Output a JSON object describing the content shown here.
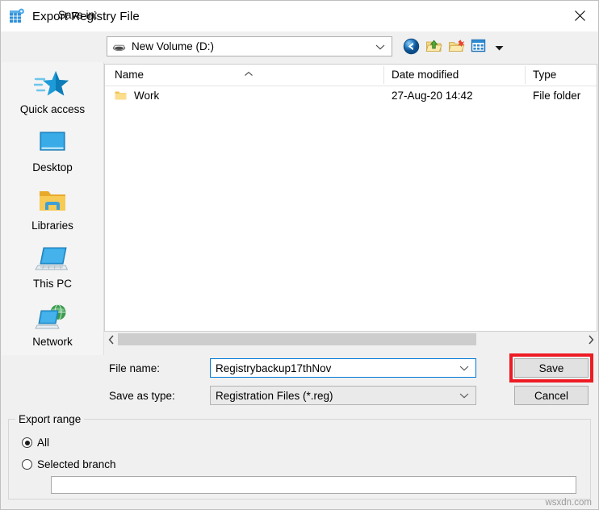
{
  "window": {
    "title": "Export Registry File",
    "icon": "registry-icon",
    "close_label": "×"
  },
  "savein": {
    "label": "Save in:",
    "value": "New Volume (D:)",
    "drive_icon": "hard-drive-icon"
  },
  "toolbar": {
    "buttons": [
      {
        "name": "back-button",
        "icon": "back-arrow-icon",
        "title": "Back"
      },
      {
        "name": "up-one-level-button",
        "icon": "folder-up-icon",
        "title": "Up One Level"
      },
      {
        "name": "create-new-folder-button",
        "icon": "new-folder-icon",
        "title": "Create New Folder"
      },
      {
        "name": "views-button",
        "icon": "views-icon",
        "title": "Views"
      }
    ]
  },
  "sidebar": {
    "items": [
      {
        "label": "Quick access",
        "icon": "star-icon"
      },
      {
        "label": "Desktop",
        "icon": "monitor-icon"
      },
      {
        "label": "Libraries",
        "icon": "libraries-folder-icon"
      },
      {
        "label": "This PC",
        "icon": "computer-icon"
      },
      {
        "label": "Network",
        "icon": "network-globe-icon"
      }
    ]
  },
  "filelist": {
    "columns": [
      "Name",
      "Date modified",
      "Type"
    ],
    "sort_indicator": "ascending",
    "rows": [
      {
        "name": "Work",
        "date_modified": "27-Aug-20 14:42",
        "type": "File folder",
        "icon": "folder-icon"
      }
    ]
  },
  "filename": {
    "label": "File name:",
    "value": "Registrybackup17thNov",
    "placeholder": ""
  },
  "savetype": {
    "label": "Save as type:",
    "value": "Registration Files (*.reg)"
  },
  "actions": {
    "save_label": "Save",
    "cancel_label": "Cancel",
    "highlight_color": "#ee1b24"
  },
  "export_range": {
    "title": "Export range",
    "options": [
      {
        "label": "All",
        "selected": true
      },
      {
        "label": "Selected branch",
        "selected": false
      }
    ],
    "branch_value": ""
  },
  "watermark": "wsxdn.com"
}
